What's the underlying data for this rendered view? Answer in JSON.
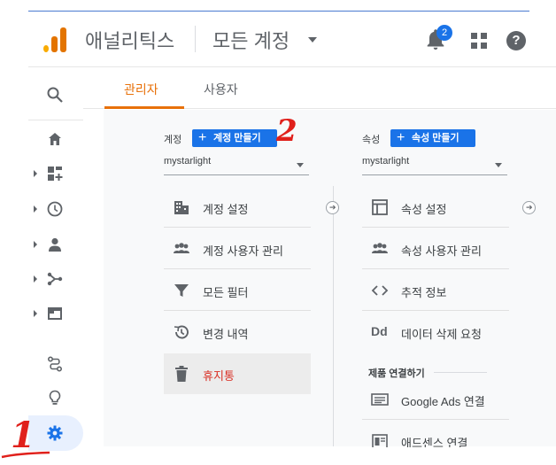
{
  "header": {
    "app_name": "애널리틱스",
    "account_name": "모든 계정",
    "notification_count": "2",
    "help_label": "?"
  },
  "tabs": [
    {
      "label": "관리자",
      "active": true
    },
    {
      "label": "사용자",
      "active": false
    }
  ],
  "sidebar": {
    "items": [
      {
        "icon": "search-icon"
      },
      {
        "icon": "home-icon"
      },
      {
        "icon": "customization-icon"
      },
      {
        "icon": "realtime-clock-icon"
      },
      {
        "icon": "audience-person-icon"
      },
      {
        "icon": "acquisition-icon"
      },
      {
        "icon": "behavior-icon"
      },
      {
        "icon": "attribution-icon"
      },
      {
        "icon": "discover-bulb-icon"
      },
      {
        "icon": "admin-gear-icon",
        "active": true
      }
    ]
  },
  "account_column": {
    "label": "계정",
    "create_button": "계정 만들기",
    "selected": "mystarlight",
    "items": [
      {
        "label": "계정 설정",
        "icon": "building-icon"
      },
      {
        "label": "계정 사용자 관리",
        "icon": "people-icon"
      },
      {
        "label": "모든 필터",
        "icon": "filter-icon"
      },
      {
        "label": "변경 내역",
        "icon": "history-icon"
      },
      {
        "label": "휴지통",
        "icon": "trash-icon",
        "active": true
      }
    ]
  },
  "property_column": {
    "label": "속성",
    "create_button": "속성 만들기",
    "selected": "mystarlight",
    "items": [
      {
        "label": "속성 설정",
        "icon": "window-icon"
      },
      {
        "label": "속성 사용자 관리",
        "icon": "people-icon"
      },
      {
        "label": "추적 정보",
        "icon": "code-icon"
      },
      {
        "label": "데이터 삭제 요청",
        "icon": "dd-icon",
        "glyph": "Dd"
      }
    ],
    "section_title": "제품 연결하기",
    "linked_items": [
      {
        "label": "Google Ads 연결",
        "icon": "ads-icon"
      },
      {
        "label": "애드센스 연결",
        "icon": "adsense-icon"
      }
    ]
  },
  "annotations": {
    "one": "1",
    "two": "2"
  },
  "colors": {
    "accent_orange": "#e8710a",
    "primary_blue": "#1a73e8",
    "annotation_red": "#e0201b",
    "trash_red": "#d93025"
  }
}
